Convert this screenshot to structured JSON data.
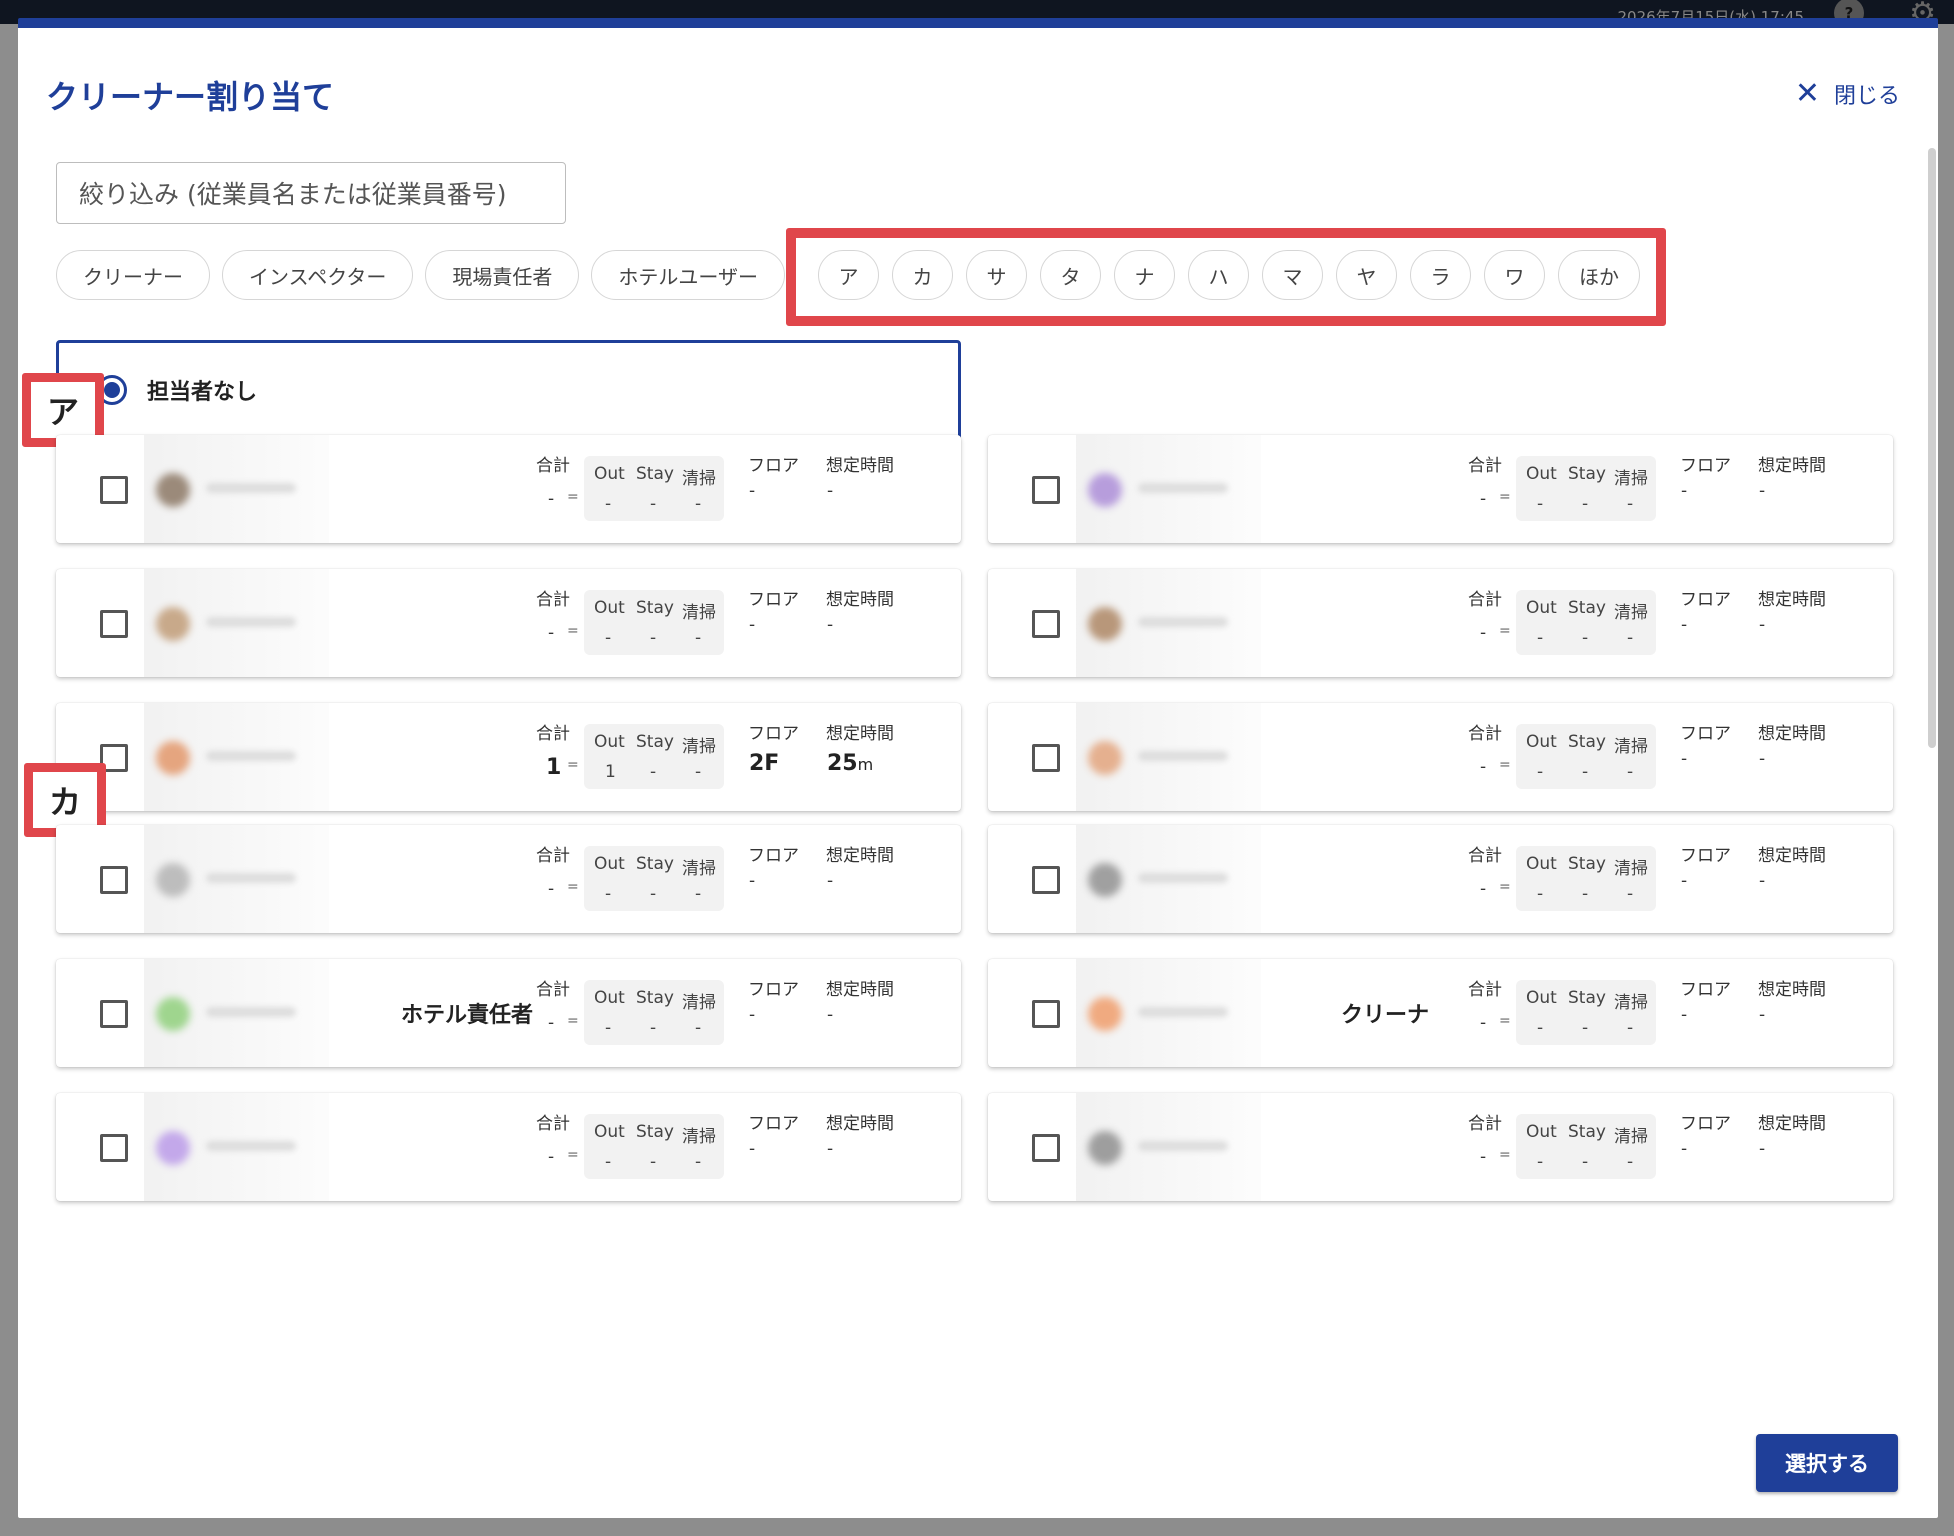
{
  "topbar": {
    "date_text": "2026年7月15日(水) 17:45"
  },
  "modal": {
    "title": "クリーナー割り当て",
    "close_label": "閉じる",
    "search_placeholder": "絞り込み (従業員名または従業員番号)",
    "role_filters": [
      "クリーナー",
      "インスペクター",
      "現場責任者",
      "ホテルユーザー"
    ],
    "kana_filters": [
      "ア",
      "カ",
      "サ",
      "タ",
      "ナ",
      "ハ",
      "マ",
      "ヤ",
      "ラ",
      "ワ",
      "ほか"
    ],
    "none_option_label": "担当者なし",
    "stat_labels": {
      "total": "合計",
      "out": "Out",
      "stay": "Stay",
      "clean": "清掃",
      "floor": "フロア",
      "time": "想定時間",
      "eq": "="
    },
    "sections": [
      {
        "label": "ア",
        "cards": [
          {
            "total": "-",
            "out": "-",
            "stay": "-",
            "clean": "-",
            "floor": "-",
            "time": "-",
            "unit": "",
            "avatar": "#9b8a7a",
            "role": ""
          },
          {
            "total": "-",
            "out": "-",
            "stay": "-",
            "clean": "-",
            "floor": "-",
            "time": "-",
            "unit": "",
            "avatar": "#b79ddc",
            "role": ""
          },
          {
            "total": "-",
            "out": "-",
            "stay": "-",
            "clean": "-",
            "floor": "-",
            "time": "-",
            "unit": "",
            "avatar": "#c8a98a",
            "role": ""
          },
          {
            "total": "-",
            "out": "-",
            "stay": "-",
            "clean": "-",
            "floor": "-",
            "time": "-",
            "unit": "",
            "avatar": "#b8977a",
            "role": ""
          },
          {
            "total": "1",
            "out": "1",
            "stay": "-",
            "clean": "-",
            "floor": "2F",
            "time": "25",
            "unit": "m",
            "avatar": "#e5a57f",
            "role": ""
          },
          {
            "total": "-",
            "out": "-",
            "stay": "-",
            "clean": "-",
            "floor": "-",
            "time": "-",
            "unit": "",
            "avatar": "#e5b08f",
            "role": ""
          }
        ]
      },
      {
        "label": "カ",
        "cards": [
          {
            "total": "-",
            "out": "-",
            "stay": "-",
            "clean": "-",
            "floor": "-",
            "time": "-",
            "unit": "",
            "avatar": "#bdbdbd",
            "role": ""
          },
          {
            "total": "-",
            "out": "-",
            "stay": "-",
            "clean": "-",
            "floor": "-",
            "time": "-",
            "unit": "",
            "avatar": "#a0a0a0",
            "role": ""
          },
          {
            "total": "-",
            "out": "-",
            "stay": "-",
            "clean": "-",
            "floor": "-",
            "time": "-",
            "unit": "",
            "avatar": "#9fd58e",
            "role": "ホテル責任者"
          },
          {
            "total": "-",
            "out": "-",
            "stay": "-",
            "clean": "-",
            "floor": "-",
            "time": "-",
            "unit": "",
            "avatar": "#f0aa80",
            "role": "クリーナ"
          },
          {
            "total": "-",
            "out": "-",
            "stay": "-",
            "clean": "-",
            "floor": "-",
            "time": "-",
            "unit": "",
            "avatar": "#c3a8ea",
            "role": ""
          },
          {
            "total": "-",
            "out": "-",
            "stay": "-",
            "clean": "-",
            "floor": "-",
            "time": "-",
            "unit": "",
            "avatar": "#9e9e9e",
            "role": ""
          }
        ]
      }
    ],
    "select_label": "選択する"
  }
}
